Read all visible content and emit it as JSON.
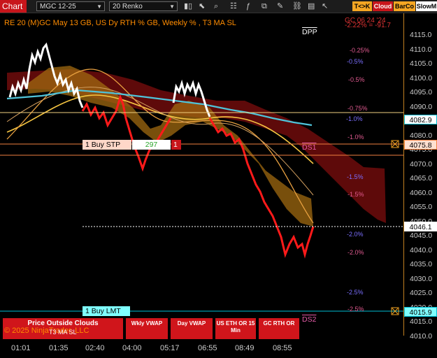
{
  "toolbar": {
    "chart_tab": "Chart",
    "instrument": "MGC 12-25",
    "bar_type": "20 Renko",
    "btn_tk": "T<>K",
    "btn_cloud": "Cloud",
    "btn_barco": "BarCo",
    "btn_slowm": "SlowM"
  },
  "title": "RE 20  (M)GC May 13 GB, US Dy RTH % GB, Weekly % , T3 MA SL",
  "top_right": {
    "label": "GC 06 24 '24",
    "value": "-2.22% = -91.7"
  },
  "y_axis": {
    "ticks": [
      "4115.0",
      "4110.0",
      "4105.0",
      "4100.0",
      "4095.0",
      "4090.0",
      "4085.0",
      "4080.0",
      "4075.0",
      "4070.0",
      "4065.0",
      "4060.0",
      "4055.0",
      "4050.0",
      "4045.0",
      "4040.0",
      "4035.0",
      "4030.0",
      "4025.0",
      "4020.0",
      "4015.0",
      "4010.0"
    ],
    "flags": [
      {
        "name": "price-flag-4082",
        "text": "4082.9",
        "bg": "#ffffff",
        "fg": "#000000",
        "border": "#00bcd4"
      },
      {
        "name": "price-flag-4075",
        "text": "4075.8",
        "bg": "#ffe0d0",
        "fg": "#000000",
        "border": "#f08040"
      },
      {
        "name": "price-flag-4046",
        "text": "4046.1",
        "bg": "#ffffff",
        "fg": "#000000",
        "border": "#ffffff"
      },
      {
        "name": "price-flag-4015",
        "text": "4015.9",
        "bg": "#7fffff",
        "fg": "#000000",
        "border": "#00bcd4"
      }
    ]
  },
  "x_axis": [
    "01:01",
    "01:35",
    "02:40",
    "04:00",
    "05:17",
    "06:55",
    "08:49",
    "08:55"
  ],
  "percent_labels": [
    {
      "name": "pct-label-1",
      "text": "-0.25%",
      "color": "#e05a90"
    },
    {
      "name": "pct-label-2",
      "text": "-0.5%",
      "color": "#7b6fff"
    },
    {
      "name": "pct-label-3",
      "text": "-0.5%",
      "color": "#e05a90"
    },
    {
      "name": "pct-label-4",
      "text": "-0.75%",
      "color": "#e05a90"
    },
    {
      "name": "pct-label-5",
      "text": "-1.0%",
      "color": "#7b6fff"
    },
    {
      "name": "pct-label-6",
      "text": "-1.0%",
      "color": "#e05a90"
    },
    {
      "name": "pct-label-7",
      "text": "-1.5%",
      "color": "#7b6fff"
    },
    {
      "name": "pct-label-8",
      "text": "-1.5%",
      "color": "#e05a90"
    },
    {
      "name": "pct-label-9",
      "text": "-2.0%",
      "color": "#7b6fff"
    },
    {
      "name": "pct-label-10",
      "text": "-2.0%",
      "color": "#e05a90"
    },
    {
      "name": "pct-label-11",
      "text": "-2.5%",
      "color": "#7b6fff"
    },
    {
      "name": "pct-label-12",
      "text": "-2.5%",
      "color": "#e05a90"
    }
  ],
  "levels": {
    "dpp": "DPP",
    "ds1": "DS1",
    "ds2": "DS2"
  },
  "orders": {
    "buy_stp": "1 Buy STP",
    "buy_stp_qty": "297",
    "buy_stp_count": "1",
    "buy_lmt": "1 Buy LMT"
  },
  "buttons": {
    "price_outside_clouds": "Price Outside Clouds",
    "price_outside_sub": "T3 MA SL",
    "wkly_vwap": "Wkly VWAP",
    "day_vwap": "Day VWAP",
    "us_eth": "US ETH OR 15 Min",
    "gc_rth": "GC RTH OR"
  },
  "copyright": "© 2025 NinjaTrader, LLC",
  "colors": {
    "accent": "#c8151b",
    "title": "#ff8c00",
    "renko_up": "#ffffff",
    "renko_down": "#ff1a1a",
    "cloud_gold": "#b8860b",
    "cloud_red": "#7a0c0c",
    "ma_cyan": "#4fc3d9"
  }
}
